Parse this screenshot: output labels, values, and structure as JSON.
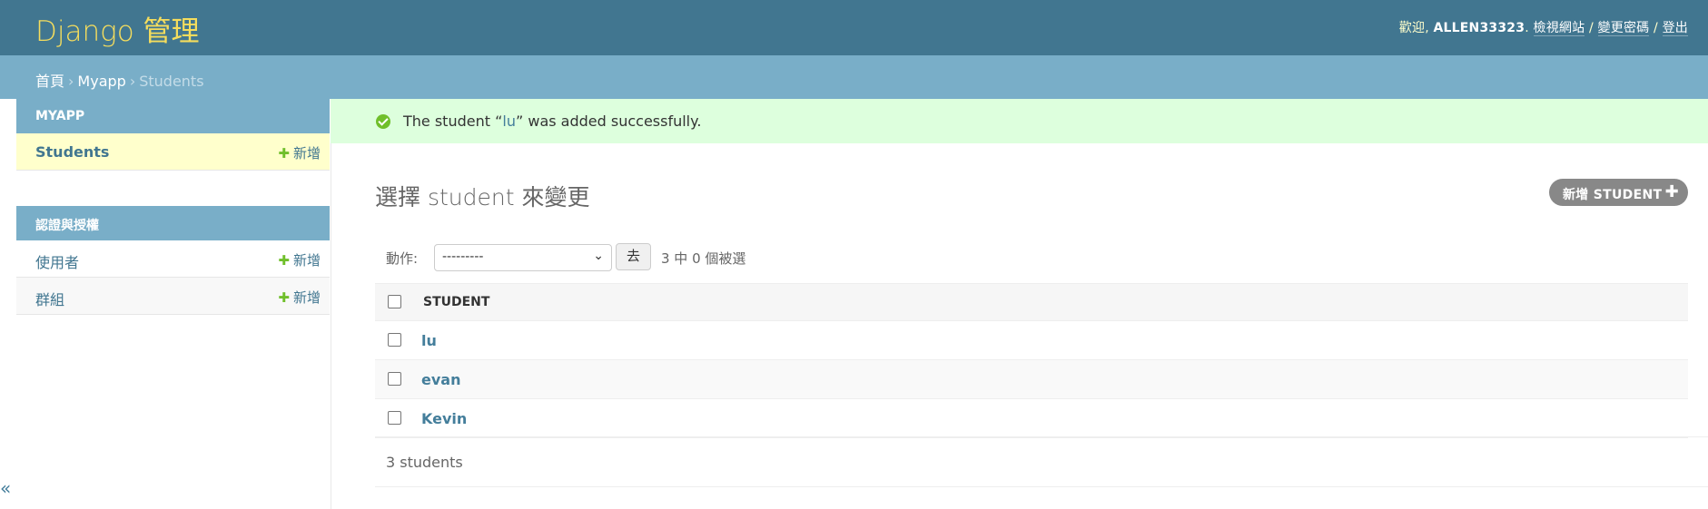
{
  "header": {
    "brand": "Django 管理",
    "welcome": "歡迎,",
    "username": "ALLEN33323",
    "view_site": "檢視網站",
    "change_password": "變更密碼",
    "logout": "登出",
    "separator": "/"
  },
  "breadcrumbs": {
    "home": "首頁",
    "app": "Myapp",
    "current": "Students",
    "arrow": "›"
  },
  "sidebar": {
    "collapse_label": "«",
    "modules": [
      {
        "caption": "MYAPP",
        "models": [
          {
            "name": "Students",
            "add_label": "新增"
          }
        ]
      },
      {
        "caption": "認證與授權",
        "models": [
          {
            "name": "使用者",
            "add_label": "新增"
          },
          {
            "name": "群組",
            "add_label": "新增"
          }
        ]
      }
    ]
  },
  "message": {
    "prefix": "The student “",
    "object": "lu",
    "suffix": "” was added successfully."
  },
  "content": {
    "title": "選擇 student 來變更",
    "add_button": "新增 STUDENT",
    "actions_label": "動作:",
    "action_selected": "---------",
    "go_label": "去",
    "action_counter": "3 中 0 個被選",
    "column_header": "STUDENT",
    "rows": [
      {
        "name": "lu"
      },
      {
        "name": "evan"
      },
      {
        "name": "Kevin"
      }
    ],
    "paginator": "3 students"
  }
}
